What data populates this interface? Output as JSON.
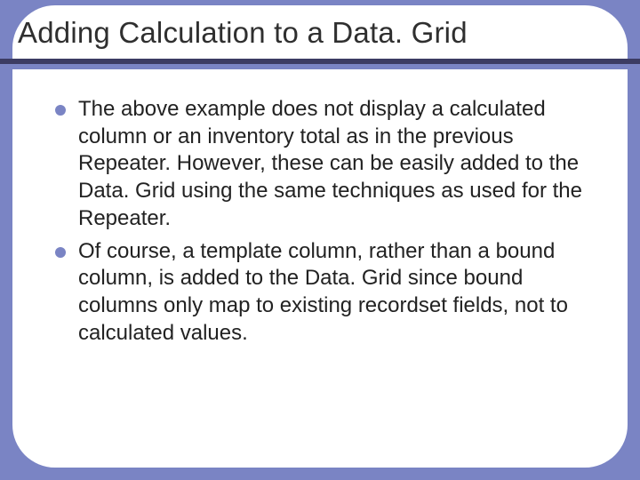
{
  "slide": {
    "title": "Adding Calculation to a Data. Grid",
    "bullets": [
      "The above example does not display a calculated column or an inventory total as in the previous Repeater. However, these can be easily added to the Data. Grid using the same techniques as used for the Repeater.",
      "Of course, a template column, rather than a bound column, is added to the Data. Grid since bound columns only map to existing recordset fields, not to calculated values."
    ]
  },
  "colors": {
    "background": "#7a84c4",
    "rule_dark": "#3c3c63",
    "bullet": "#7a84c4"
  }
}
